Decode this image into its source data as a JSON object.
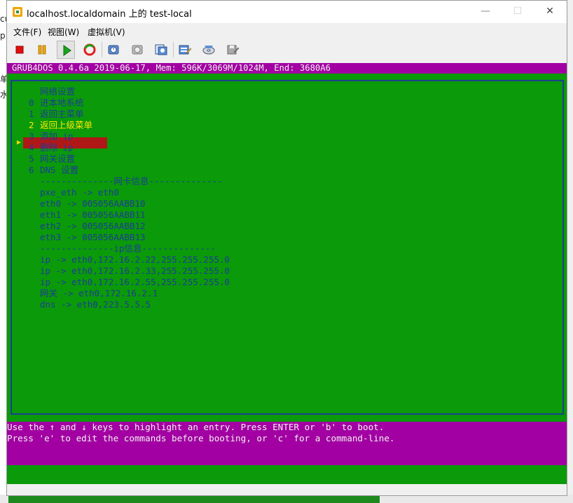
{
  "background_fragments": [
    "cu",
    "p",
    "单",
    "水"
  ],
  "window": {
    "title": "localhost.localdomain 上的 test-local",
    "controls": {
      "minimize": "—",
      "maximize": "☐",
      "close": "✕"
    }
  },
  "menubar": {
    "file": "文件(F)",
    "view": "视图(W)",
    "vm": "虚拟机(V)"
  },
  "toolbar": {
    "icons": [
      "stop-icon",
      "pause-icon",
      "play-icon",
      "reset-icon",
      "snapshot-icon",
      "revert-snapshot-icon",
      "manage-snapshot-icon",
      "edit-settings-icon",
      "cd-icon",
      "floppy-icon"
    ]
  },
  "console": {
    "header": "GRUB4DOS 0.4.6a 2019-06-17, Mem: 596K/3069M/1024M, End: 3680A6",
    "title": "网络设置",
    "entries": [
      {
        "num": "0",
        "label": "进本地系统"
      },
      {
        "num": "1",
        "label": "返回主菜单"
      },
      {
        "num": "2",
        "label": "返回上级菜单"
      },
      {
        "num": "3",
        "label": "添加 ip"
      },
      {
        "num": "4",
        "label": "删除 ip"
      },
      {
        "num": "5",
        "label": "网关设置"
      },
      {
        "num": "6",
        "label": "DNS 设置"
      }
    ],
    "selected_index": 2,
    "selection_marker": "▶",
    "info_lines": [
      "--------------网卡信息--------------",
      "pxe_eth -> eth0",
      "eth0 -> 005056AABB10",
      "eth1 -> 005056AABB11",
      "eth2 -> 005056AABB12",
      "eth3 -> 005056AABB13",
      "--------------ip信息--------------",
      "ip -> eth0,172.16.2.22,255.255.255.0",
      "ip -> eth0,172.16.2.33,255.255.255.0",
      "ip -> eth0,172.16.2.55,255.255.255.0",
      "网关 -> eth0,172.16.2.1",
      "dns -> eth0,223.5.5.5"
    ],
    "help": [
      "Use the ↑ and ↓ keys to highlight an entry. Press ENTER or 'b' to boot.",
      "Press 'e' to edit the commands before booting, or 'c' for a command-line."
    ]
  },
  "colors": {
    "console_green": "#0a9a0a",
    "grub_magenta": "#a200a2",
    "menu_text_blue": "#1e3c96",
    "selection_red": "#b01818",
    "selection_yellow": "#ffe800"
  }
}
